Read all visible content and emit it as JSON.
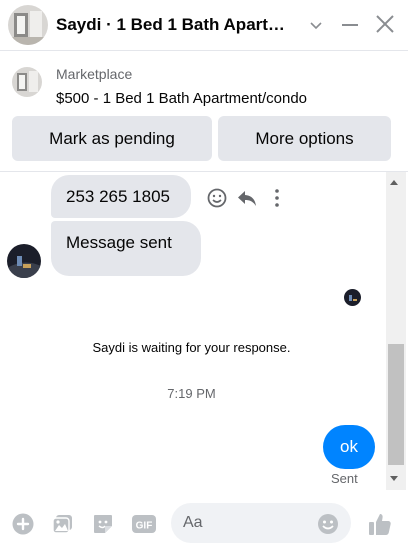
{
  "header": {
    "title": "Saydi · 1 Bed 1 Bath Apart…"
  },
  "marketplace": {
    "label": "Marketplace",
    "listing": "$500 - 1 Bed 1 Bath Apartment/condo"
  },
  "actions": {
    "pending_label": "Mark as pending",
    "more_label": "More options"
  },
  "messages": {
    "phone": "253 265 1805",
    "sent_msg": "Message sent",
    "waiting": "Saydi is waiting for your response.",
    "time": "7:19 PM",
    "outgoing": "ok",
    "status": "Sent"
  },
  "composer": {
    "placeholder": "Aa",
    "gif_label": "GIF"
  },
  "colors": {
    "accent": "#0084ff",
    "bubble_gray": "#e4e6eb",
    "muted_text": "#65676b"
  },
  "icons": [
    "chevron-down-icon",
    "minimize-icon",
    "close-icon",
    "emoji-reaction-icon",
    "reply-icon",
    "more-vertical-icon",
    "add-icon",
    "photo-icon",
    "sticker-icon",
    "gif-icon",
    "emoji-icon",
    "thumbs-up-icon"
  ]
}
